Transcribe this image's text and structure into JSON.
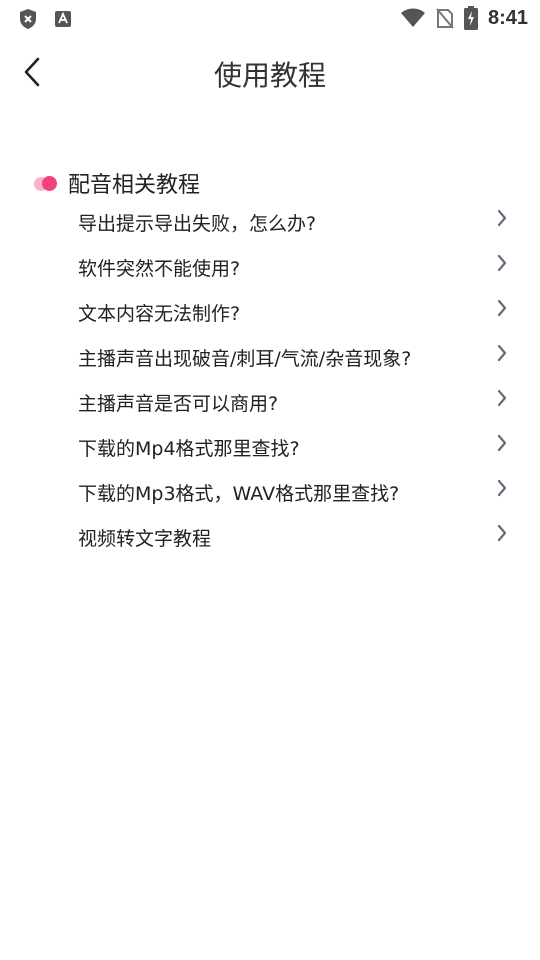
{
  "status_bar": {
    "time": "8:41"
  },
  "header": {
    "title": "使用教程"
  },
  "section": {
    "title": "配音相关教程",
    "items": [
      {
        "label": "导出提示导出失败，怎么办?"
      },
      {
        "label": "软件突然不能使用?"
      },
      {
        "label": "文本内容无法制作?"
      },
      {
        "label": "主播声音出现破音/刺耳/气流/杂音现象?"
      },
      {
        "label": "主播声音是否可以商用?"
      },
      {
        "label": "下载的Mp4格式那里查找?"
      },
      {
        "label": "下载的Mp3格式，WAV格式那里查找?"
      },
      {
        "label": "视频转文字教程"
      }
    ]
  },
  "colors": {
    "accent": "#f2427a",
    "accent_light": "#f7b4c8",
    "chevron": "#666a78"
  }
}
